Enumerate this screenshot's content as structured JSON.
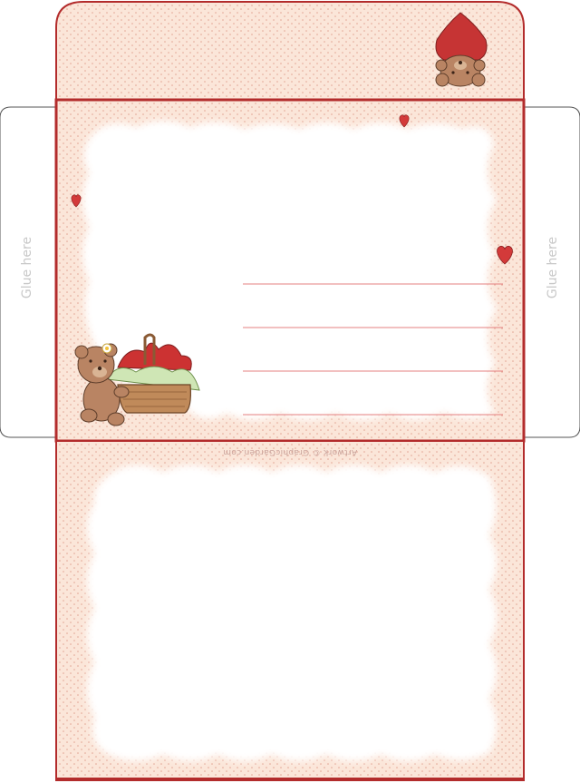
{
  "envelope": {
    "left_flap_label": "Glue here",
    "right_flap_label": "Glue here",
    "credit": "Artwork © GraphicGarden.com",
    "colors": {
      "background": "#fbe6d9",
      "dots": "#e3a493",
      "border": "#b32c2c",
      "address_line": "#e48080",
      "heart": "#d33a3a"
    },
    "address_lines_count": 4,
    "icons": [
      "heart-icon",
      "teddy-bear-icon",
      "heart-basket-icon",
      "teddy-bear-with-heart-icon"
    ]
  }
}
